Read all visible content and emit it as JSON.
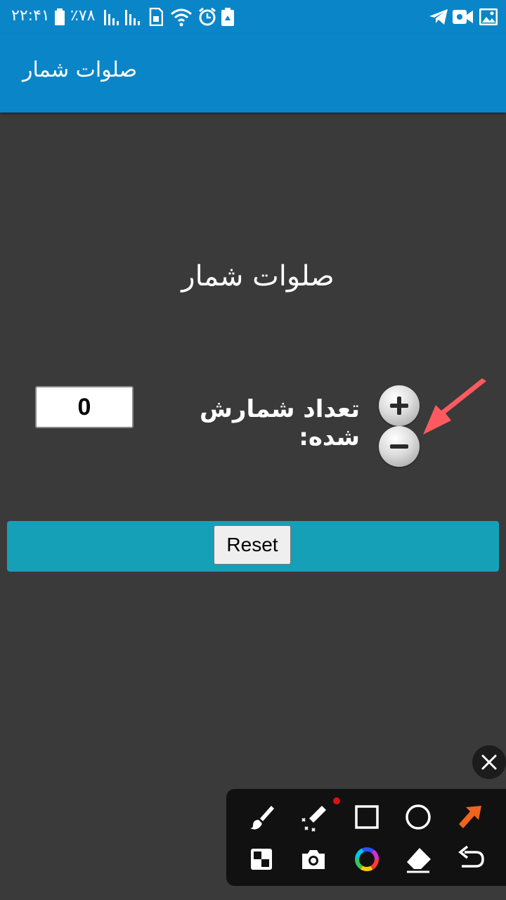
{
  "status_bar": {
    "time": "۲۲:۴۱",
    "battery_percent": "٪۷۸",
    "icons": [
      "battery-icon",
      "signal-icon",
      "signal-icon",
      "sim-icon",
      "wifi-icon",
      "alarm-icon",
      "recycle-icon",
      "telegram-icon",
      "video-icon",
      "image-icon"
    ]
  },
  "app_bar": {
    "title": "صلوات شمار"
  },
  "main": {
    "heading": "صلوات شمار",
    "count_label": "تعداد شمارش شده:",
    "count_value": "0",
    "increment_icon": "plus-icon",
    "decrement_icon": "minus-icon",
    "reset_label": "Reset"
  },
  "overlay": {
    "annotation_arrow_color": "#ff5a5f",
    "toolbar_tools": [
      "brush-icon",
      "magic-pen-icon",
      "rectangle-icon",
      "circle-icon",
      "arrow-icon",
      "mosaic-icon",
      "camera-icon",
      "color-wheel-icon",
      "eraser-icon",
      "undo-icon"
    ],
    "close_icon": "close-icon"
  },
  "colors": {
    "primary": "#0a86c8",
    "background": "#3a3a3a",
    "reset_bar": "#16a0b8",
    "arrow_tool": "#f0641e"
  }
}
